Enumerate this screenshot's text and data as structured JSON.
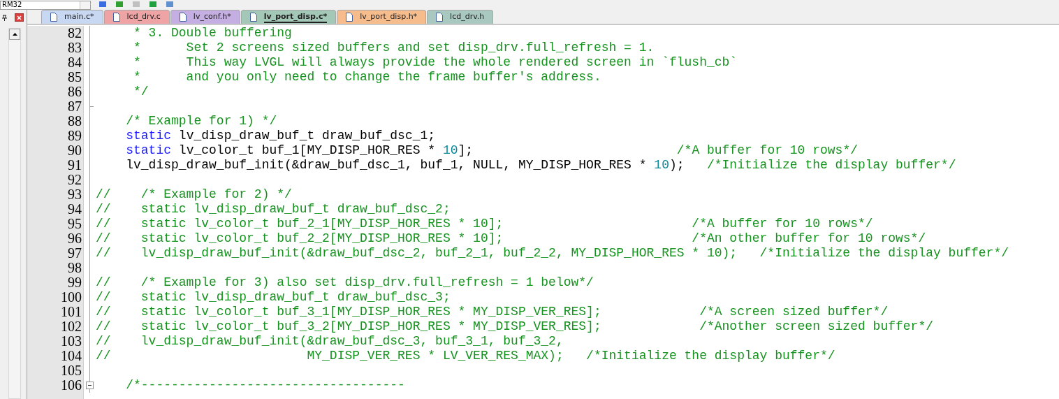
{
  "toolbar": {
    "target": "RM32"
  },
  "tabs": [
    {
      "label": "main.c*",
      "color": "#c8d8f2",
      "selected": false
    },
    {
      "label": "lcd_drv.c",
      "color": "#eea4a4",
      "selected": false
    },
    {
      "label": "lv_conf.h*",
      "color": "#c4aee2",
      "selected": false
    },
    {
      "label": "lv_port_disp.c*",
      "color": "#a4c8b8",
      "selected": true
    },
    {
      "label": "lv_port_disp.h*",
      "color": "#f6bc8c",
      "selected": false
    },
    {
      "label": "lcd_drv.h",
      "color": "#a8c8c0",
      "selected": false
    }
  ],
  "editor": {
    "lines": [
      {
        "number": "82",
        "segments": [
          {
            "kind": "comment",
            "text": "     * 3. Double buffering"
          }
        ]
      },
      {
        "number": "83",
        "segments": [
          {
            "kind": "comment",
            "text": "     *      Set 2 screens sized buffers and set disp_drv.full_refresh = 1."
          }
        ]
      },
      {
        "number": "84",
        "segments": [
          {
            "kind": "comment",
            "text": "     *      This way LVGL will always provide the whole rendered screen in `flush_cb`"
          }
        ]
      },
      {
        "number": "85",
        "segments": [
          {
            "kind": "comment",
            "text": "     *      and you only need to change the frame buffer's address."
          }
        ]
      },
      {
        "number": "86",
        "segments": [
          {
            "kind": "comment",
            "text": "     */"
          }
        ]
      },
      {
        "number": "87",
        "block_end": true
      },
      {
        "number": "88",
        "segments": [
          {
            "kind": "comment",
            "text": "    /* Example for 1) */"
          }
        ]
      },
      {
        "number": "89",
        "segments": [
          {
            "kind": "keyword",
            "text": "    static"
          },
          {
            "kind": "plain",
            "text": " lv_disp_draw_buf_t draw_buf_dsc_1;"
          }
        ]
      },
      {
        "number": "90",
        "segments": [
          {
            "kind": "keyword",
            "text": "    static"
          },
          {
            "kind": "plain",
            "text": " lv_color_t buf_1[MY_DISP_HOR_RES * "
          },
          {
            "kind": "number",
            "text": "10"
          },
          {
            "kind": "plain",
            "text": "];                           "
          },
          {
            "kind": "comment",
            "text": "/*A buffer for 10 rows*/"
          }
        ]
      },
      {
        "number": "91",
        "segments": [
          {
            "kind": "plain",
            "text": "    lv_disp_draw_buf_init(&draw_buf_dsc_1, buf_1, NULL, MY_DISP_HOR_RES * "
          },
          {
            "kind": "number",
            "text": "10"
          },
          {
            "kind": "plain",
            "text": ");   "
          },
          {
            "kind": "comment",
            "text": "/*Initialize the display buffer*/"
          }
        ]
      },
      {
        "number": "92"
      },
      {
        "number": "93",
        "segments": [
          {
            "kind": "comment",
            "text": "//    /* Example for 2) */"
          }
        ]
      },
      {
        "number": "94",
        "segments": [
          {
            "kind": "comment",
            "text": "//    static lv_disp_draw_buf_t draw_buf_dsc_2;"
          }
        ]
      },
      {
        "number": "95",
        "segments": [
          {
            "kind": "comment",
            "text": "//    static lv_color_t buf_2_1[MY_DISP_HOR_RES * 10];                         /*A buffer for 10 rows*/"
          }
        ]
      },
      {
        "number": "96",
        "segments": [
          {
            "kind": "comment",
            "text": "//    static lv_color_t buf_2_2[MY_DISP_HOR_RES * 10];                         /*An other buffer for 10 rows*/"
          }
        ]
      },
      {
        "number": "97",
        "segments": [
          {
            "kind": "comment",
            "text": "//    lv_disp_draw_buf_init(&draw_buf_dsc_2, buf_2_1, buf_2_2, MY_DISP_HOR_RES * 10);   /*Initialize the display buffer*/"
          }
        ]
      },
      {
        "number": "98"
      },
      {
        "number": "99",
        "segments": [
          {
            "kind": "comment",
            "text": "//    /* Example for 3) also set disp_drv.full_refresh = 1 below*/"
          }
        ]
      },
      {
        "number": "100",
        "segments": [
          {
            "kind": "comment",
            "text": "//    static lv_disp_draw_buf_t draw_buf_dsc_3;"
          }
        ]
      },
      {
        "number": "101",
        "segments": [
          {
            "kind": "comment",
            "text": "//    static lv_color_t buf_3_1[MY_DISP_HOR_RES * MY_DISP_VER_RES];             /*A screen sized buffer*/"
          }
        ]
      },
      {
        "number": "102",
        "segments": [
          {
            "kind": "comment",
            "text": "//    static lv_color_t buf_3_2[MY_DISP_HOR_RES * MY_DISP_VER_RES];             /*Another screen sized buffer*/"
          }
        ]
      },
      {
        "number": "103",
        "segments": [
          {
            "kind": "comment",
            "text": "//    lv_disp_draw_buf_init(&draw_buf_dsc_3, buf_3_1, buf_3_2,"
          }
        ]
      },
      {
        "number": "104",
        "segments": [
          {
            "kind": "comment",
            "text": "//                          MY_DISP_VER_RES * LV_VER_RES_MAX);   /*Initialize the display buffer*/"
          }
        ]
      },
      {
        "number": "105"
      },
      {
        "number": "106",
        "collapsible": true,
        "segments": [
          {
            "kind": "comment",
            "text": "    /*-----------------------------------"
          }
        ]
      }
    ]
  }
}
